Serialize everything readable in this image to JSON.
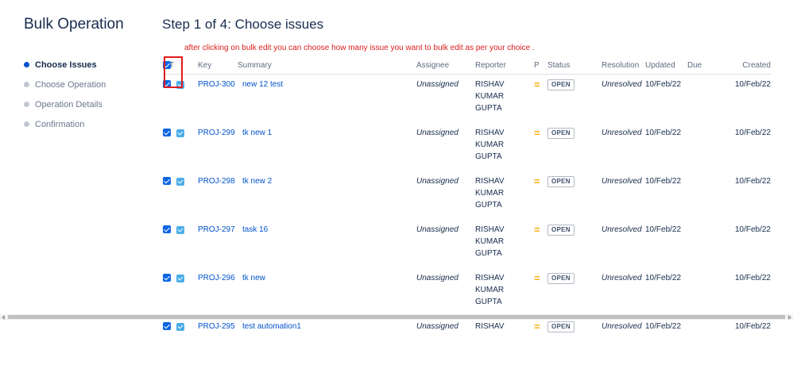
{
  "sidebar": {
    "title": "Bulk Operation",
    "steps": [
      {
        "label": "Choose Issues"
      },
      {
        "label": "Choose Operation"
      },
      {
        "label": "Operation Details"
      },
      {
        "label": "Confirmation"
      }
    ]
  },
  "main": {
    "title": "Step 1 of 4: Choose issues",
    "annotation": "after clicking on bulk edit you can choose how many issue you want to bulk edit as per your choice .",
    "columns": {
      "type": "T",
      "key": "Key",
      "summary": "Summary",
      "assignee": "Assignee",
      "reporter": "Reporter",
      "priority": "P",
      "status": "Status",
      "resolution": "Resolution",
      "updated": "Updated",
      "due": "Due",
      "created": "Created"
    },
    "rows": [
      {
        "key": "PROJ-300",
        "summary": "new 12 test",
        "assignee": "Unassigned",
        "reporter": "RISHAV KUMAR GUPTA",
        "priority": "=",
        "status": "OPEN",
        "resolution": "Unresolved",
        "updated": "10/Feb/22",
        "due": "",
        "created": "10/Feb/22"
      },
      {
        "key": "PROJ-299",
        "summary": "tk new 1",
        "assignee": "Unassigned",
        "reporter": "RISHAV KUMAR GUPTA",
        "priority": "=",
        "status": "OPEN",
        "resolution": "Unresolved",
        "updated": "10/Feb/22",
        "due": "",
        "created": "10/Feb/22"
      },
      {
        "key": "PROJ-298",
        "summary": "tk new 2",
        "assignee": "Unassigned",
        "reporter": "RISHAV KUMAR GUPTA",
        "priority": "=",
        "status": "OPEN",
        "resolution": "Unresolved",
        "updated": "10/Feb/22",
        "due": "",
        "created": "10/Feb/22"
      },
      {
        "key": "PROJ-297",
        "summary": "task 16",
        "assignee": "Unassigned",
        "reporter": "RISHAV KUMAR GUPTA",
        "priority": "=",
        "status": "OPEN",
        "resolution": "Unresolved",
        "updated": "10/Feb/22",
        "due": "",
        "created": "10/Feb/22"
      },
      {
        "key": "PROJ-296",
        "summary": "tk new",
        "assignee": "Unassigned",
        "reporter": "RISHAV KUMAR GUPTA",
        "priority": "=",
        "status": "OPEN",
        "resolution": "Unresolved",
        "updated": "10/Feb/22",
        "due": "",
        "created": "10/Feb/22"
      },
      {
        "key": "PROJ-295",
        "summary": "test automation1",
        "assignee": "Unassigned",
        "reporter": "RISHAV",
        "priority": "=",
        "status": "OPEN",
        "resolution": "Unresolved",
        "updated": "10/Feb/22",
        "due": "",
        "created": "10/Feb/22"
      }
    ]
  },
  "colors": {
    "accent": "#0052cc",
    "checkbox": "#0c66e4",
    "annotation": "#de1d1d",
    "priority_medium": "#ffab00"
  },
  "icons": {
    "row_checkbox": "checkbox-checked-icon",
    "issue_type": "task-type-icon",
    "priority": "priority-medium-icon"
  }
}
